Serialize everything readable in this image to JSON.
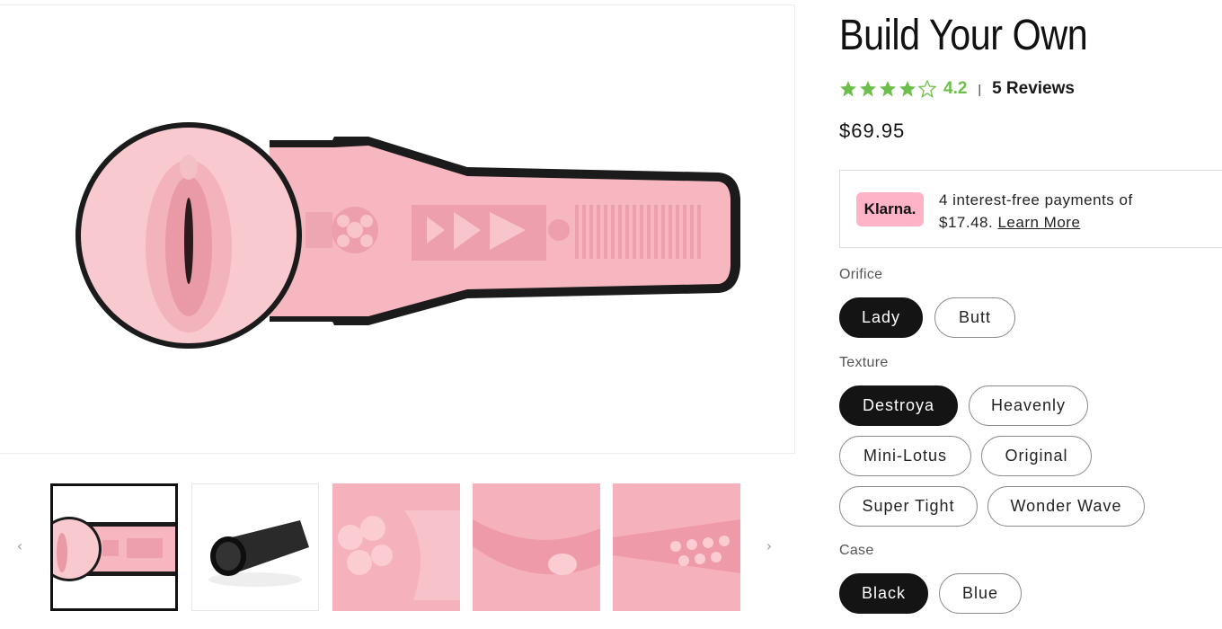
{
  "product": {
    "title": "Build Your Own",
    "rating": 4.2,
    "rating_text": "4.2",
    "stars_filled": 4,
    "stars_total": 5,
    "reviews_label": "5 Reviews",
    "price": "$69.95",
    "separator": "|"
  },
  "klarna": {
    "badge": "Klarna.",
    "line1": "4 interest-free payments of",
    "line2": "$17.48.",
    "link": "Learn More"
  },
  "options": {
    "orifice": {
      "label": "Orifice",
      "choices": [
        "Lady",
        "Butt"
      ],
      "selected": "Lady"
    },
    "texture": {
      "label": "Texture",
      "choices": [
        "Destroya",
        "Heavenly",
        "Mini-Lotus",
        "Original",
        "Super Tight",
        "Wonder Wave"
      ],
      "selected": "Destroya"
    },
    "case": {
      "label": "Case",
      "choices": [
        "Black",
        "Blue"
      ],
      "selected": "Black"
    }
  },
  "gallery": {
    "prev_icon": "‹",
    "next_icon": "›",
    "thumbnails": [
      "cutaway-view",
      "case-view",
      "texture-closeup-1",
      "texture-closeup-2",
      "texture-closeup-3"
    ],
    "active_index": 0
  },
  "colors": {
    "star_green": "#6cbf4b",
    "pink": "#f6b7c0",
    "klarna_pink": "#ffb3c7",
    "selected_pill": "#141414"
  }
}
